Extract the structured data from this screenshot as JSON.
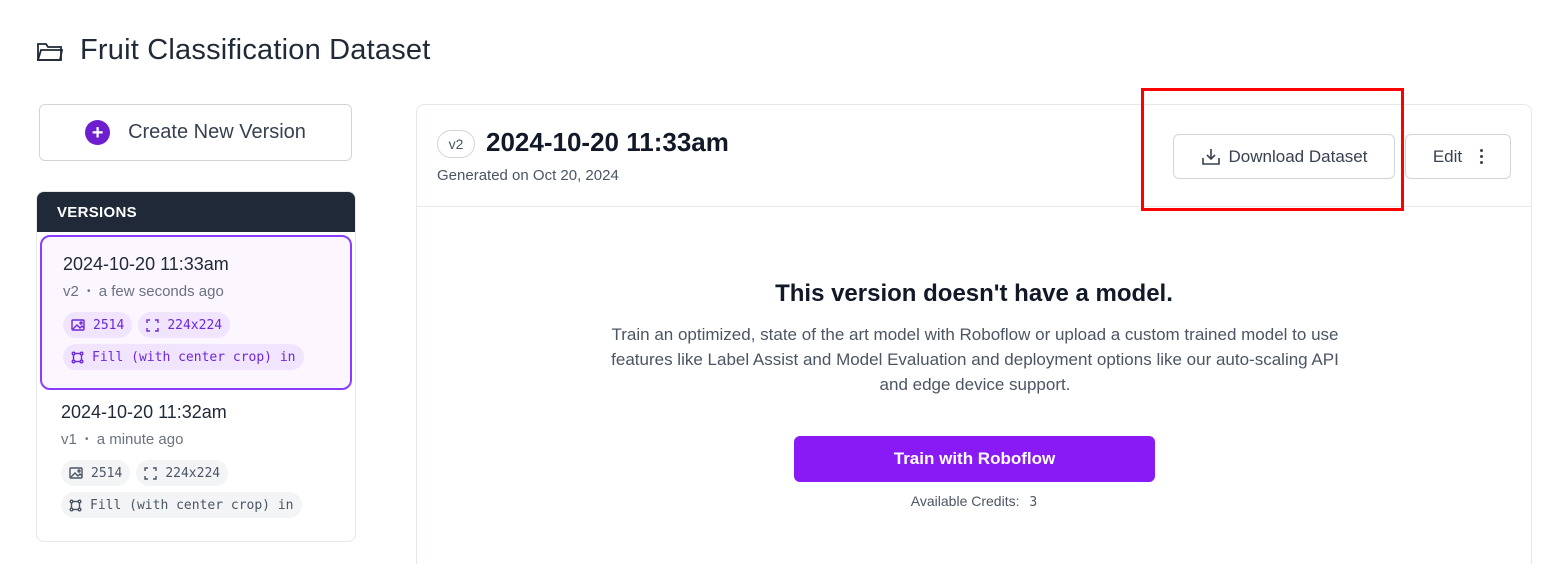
{
  "page": {
    "title": "Fruit Classification Dataset",
    "icon": "folder-icon"
  },
  "sidebar": {
    "create_label": "Create New Version",
    "versions_header": "VERSIONS",
    "versions": [
      {
        "date": "2024-10-20 11:33am",
        "tag": "v2",
        "age": "a few seconds ago",
        "images": "2514",
        "size": "224x224",
        "resize": "Fill (with center crop) in",
        "active": true
      },
      {
        "date": "2024-10-20 11:32am",
        "tag": "v1",
        "age": "a minute ago",
        "images": "2514",
        "size": "224x224",
        "resize": "Fill (with center crop) in",
        "active": false
      }
    ],
    "separator": "•"
  },
  "main": {
    "version_badge": "v2",
    "title": "2024-10-20 11:33am",
    "generated": "Generated on Oct 20, 2024",
    "download_label": "Download Dataset",
    "edit_label": "Edit",
    "empty_title": "This version doesn't have a model.",
    "empty_desc": "Train an optimized, state of the art model with Roboflow or upload a custom trained model to use features like Label Assist and Model Evaluation and deployment options like our auto-scaling API and edge device support.",
    "train_label": "Train with Roboflow",
    "credits_label": "Available Credits:",
    "credits_value": "3"
  },
  "colors": {
    "accent": "#8a1af5",
    "active_border": "#8b3dff",
    "header_dark": "#1f2937",
    "highlight": "#ff0000"
  }
}
